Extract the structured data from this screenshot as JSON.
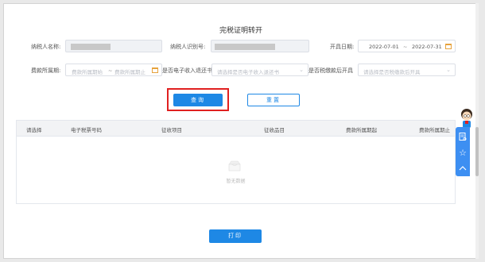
{
  "page": {
    "title": "完税证明转开"
  },
  "form": {
    "taxpayer_name_label": "纳税人名称:",
    "taxpayer_id_label": "纳税人识别号:",
    "open_date_label": "开具日期:",
    "open_date_start": "2022-07-01",
    "open_date_sep": "~",
    "open_date_end": "2022-07-31",
    "period_label": "费款所属期:",
    "period_start_placeholder": "费款所属期始",
    "period_sep": "~",
    "period_end_placeholder": "费款所属期止",
    "e_refund_label": "是否电子收入退还书",
    "e_refund_placeholder": "请选择是否电子收入退还书",
    "pay_later_label": "是否税缴款后开具",
    "pay_later_placeholder": "请选择是否税缴款后开具"
  },
  "buttons": {
    "query": "查询",
    "reset": "重置",
    "print": "打印"
  },
  "table": {
    "columns": [
      "请选择",
      "电子税票号码",
      "征收项目",
      "征收品目",
      "费款所属期起",
      "费款所属期止"
    ],
    "empty_text": "暂无数据"
  },
  "colors": {
    "primary": "#1e88e5",
    "highlight": "#e02020",
    "calendar_icon": "#e6a23c"
  }
}
